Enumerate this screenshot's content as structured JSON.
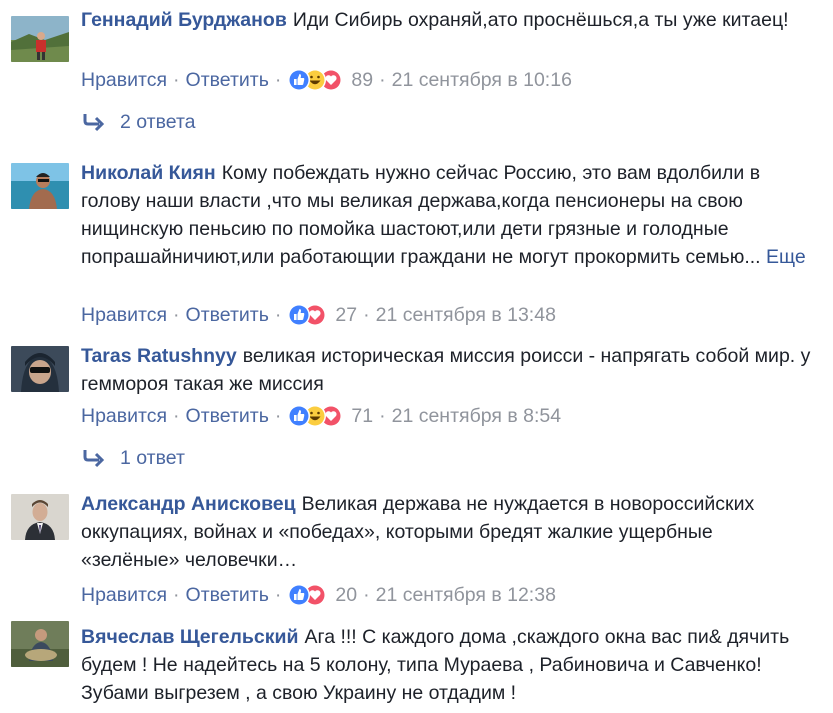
{
  "actions": {
    "like_label": "Нравится",
    "reply_label": "Ответить",
    "more_label": "Еще"
  },
  "colors": {
    "author_link": "#365899",
    "action_link": "#4b67a1",
    "meta_text": "#90949c",
    "like_blue": "#4080ff",
    "haha_yellow": "#fbcd3f",
    "love_red": "#f25268"
  },
  "comments": [
    {
      "author": "Геннадий Бурджанов",
      "text": "Иди Сибирь охраняй,ато проснёшься,а ты уже китаец!",
      "reactions": [
        "like-icon",
        "haha-icon",
        "love-icon"
      ],
      "count": "89",
      "time": "21 сентября в 10:16",
      "replies": "2 ответа"
    },
    {
      "author": "Николай Киян",
      "text": "Кому побеждать нужно сейчас Россию, это вам вдолбили в голову наши власти ,что мы великая держава,когда пенсионеры на свою нищинскую пеньсию по помойка шастоют,или дети грязные и голодные попрашайничиют,или работающии граждани не могут прокормить семью...",
      "reactions": [
        "like-icon",
        "love-icon"
      ],
      "count": "27",
      "time": "21 сентября в 13:48"
    },
    {
      "author": "Taras Ratushnyy",
      "text": "великая историческая миссия роисси - напрягать собой мир. у геммороя такая же миссия",
      "reactions": [
        "like-icon",
        "haha-icon",
        "love-icon"
      ],
      "count": "71",
      "time": "21 сентября в 8:54",
      "replies": "1 ответ"
    },
    {
      "author": "Александр Анисковец",
      "text": "Великая держава не нуждается в новороссийских оккупациях, войнах и «победах», которыми бредят жалкие ущербные «зелёные» человечки…",
      "reactions": [
        "like-icon",
        "love-icon"
      ],
      "count": "20",
      "time": "21 сентября в 12:38"
    },
    {
      "author": "Вячеслав Щегельский",
      "text": "Ага !!! С каждого дома ,скаждого окна вас пи& дячить будем ! Не надейтесь на 5 колону, типа Мураева , Рабиновича и Савченко! Зубами выгрезем , а свою Украину не отдадим !"
    }
  ]
}
